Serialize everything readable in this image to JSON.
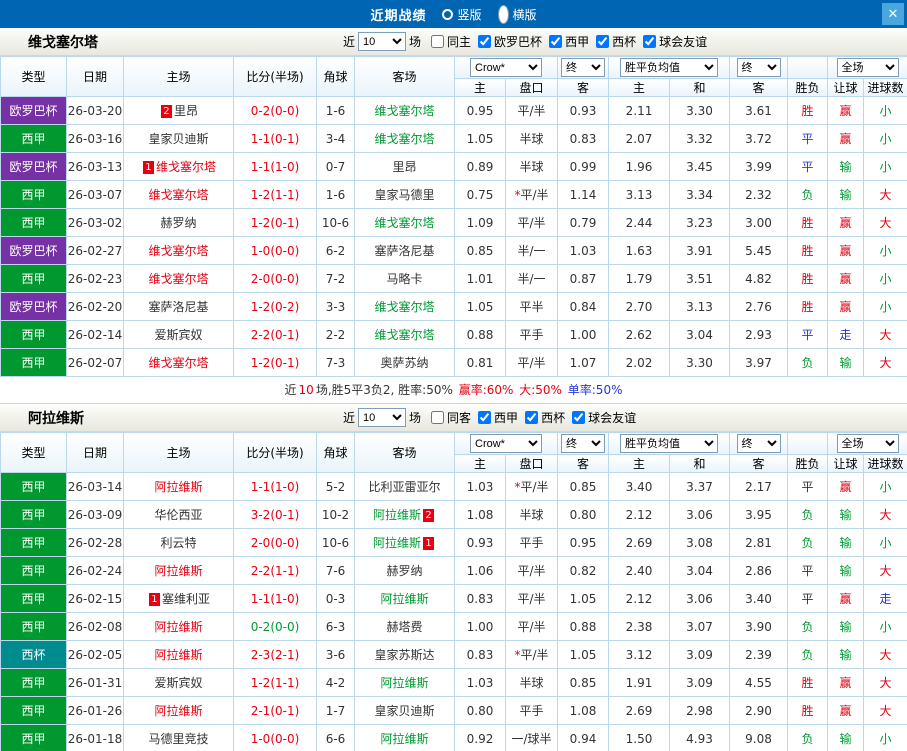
{
  "titlebar": {
    "title": "近期战绩",
    "options": [
      {
        "label": "竖版",
        "selected": false
      },
      {
        "label": "横版",
        "selected": true
      }
    ],
    "close_label": "✕"
  },
  "colors": {
    "header_blue": "#0066b3",
    "close_blue": "#49a7de",
    "red": "#e60012",
    "green": "#009933",
    "blue": "#2437d8",
    "europa_purple": "#7632a4",
    "laliga_green": "#00982f",
    "cup_teal": "#008b8f"
  },
  "columns": {
    "type": "类型",
    "date": "日期",
    "home": "主场",
    "score": "比分(半场)",
    "corner": "角球",
    "away": "客场",
    "odds_home": "主",
    "odds_handicap": "盘口",
    "odds_away": "客",
    "avg_win": "主",
    "avg_draw": "和",
    "avg_lose": "客",
    "result": "胜负",
    "handicap_result": "让球",
    "goals": "进球数"
  },
  "selects": {
    "odds_source": "Crow*",
    "final_a": "终",
    "avg_label": "胜平负均值",
    "final_b": "终",
    "scope": "全场"
  },
  "sections": [
    {
      "team": "维戈塞尔塔",
      "filters": {
        "near": "近",
        "count": "10",
        "games": "场",
        "same": {
          "label": "同主",
          "checked": false
        },
        "leagues": [
          {
            "label": "欧罗巴杯",
            "checked": true
          },
          {
            "label": "西甲",
            "checked": true
          },
          {
            "label": "西杯",
            "checked": true
          },
          {
            "label": "球会友谊",
            "checked": true
          }
        ]
      },
      "rows": [
        {
          "league": "欧罗巴杯",
          "lg": "purple",
          "date": "26-03-20",
          "home": {
            "name": "里昂",
            "color": "black",
            "badge": "2",
            "badge_pos": "before"
          },
          "score": "0-2(0-0)",
          "score_color": "red",
          "corner": "1-6",
          "away": {
            "name": "维戈塞尔塔",
            "color": "green"
          },
          "odds": [
            "0.95",
            "平/半",
            "0.93",
            "2.11",
            "3.30",
            "3.61"
          ],
          "results": [
            [
              "胜",
              "red"
            ],
            [
              "赢",
              "red"
            ],
            [
              "小",
              "green"
            ]
          ]
        },
        {
          "league": "西甲",
          "lg": "green",
          "date": "26-03-16",
          "home": {
            "name": "皇家贝迪斯",
            "color": "black"
          },
          "score": "1-1(0-1)",
          "score_color": "red",
          "corner": "3-4",
          "away": {
            "name": "维戈塞尔塔",
            "color": "green"
          },
          "odds": [
            "1.05",
            "半球",
            "0.83",
            "2.07",
            "3.32",
            "3.72"
          ],
          "results": [
            [
              "平",
              "blue"
            ],
            [
              "赢",
              "red"
            ],
            [
              "小",
              "green"
            ]
          ]
        },
        {
          "league": "欧罗巴杯",
          "lg": "purple",
          "date": "26-03-13",
          "home": {
            "name": "维戈塞尔塔",
            "color": "red",
            "badge": "1",
            "badge_pos": "before"
          },
          "score": "1-1(1-0)",
          "score_color": "red",
          "corner": "0-7",
          "away": {
            "name": "里昂",
            "color": "black"
          },
          "odds": [
            "0.89",
            "半球",
            "0.99",
            "1.96",
            "3.45",
            "3.99"
          ],
          "results": [
            [
              "平",
              "blue"
            ],
            [
              "输",
              "green"
            ],
            [
              "小",
              "green"
            ]
          ]
        },
        {
          "league": "西甲",
          "lg": "green",
          "date": "26-03-07",
          "home": {
            "name": "维戈塞尔塔",
            "color": "red"
          },
          "score": "1-2(1-1)",
          "score_color": "red",
          "corner": "1-6",
          "away": {
            "name": "皇家马德里",
            "color": "black"
          },
          "odds": [
            "0.75",
            "*平/半",
            "1.14",
            "3.13",
            "3.34",
            "2.32"
          ],
          "results": [
            [
              "负",
              "green"
            ],
            [
              "输",
              "green"
            ],
            [
              "大",
              "red"
            ]
          ]
        },
        {
          "league": "西甲",
          "lg": "green",
          "date": "26-03-02",
          "home": {
            "name": "赫罗纳",
            "color": "black"
          },
          "score": "1-2(0-1)",
          "score_color": "red",
          "corner": "10-6",
          "away": {
            "name": "维戈塞尔塔",
            "color": "green"
          },
          "odds": [
            "1.09",
            "平/半",
            "0.79",
            "2.44",
            "3.23",
            "3.00"
          ],
          "results": [
            [
              "胜",
              "red"
            ],
            [
              "赢",
              "red"
            ],
            [
              "大",
              "red"
            ]
          ]
        },
        {
          "league": "欧罗巴杯",
          "lg": "purple",
          "date": "26-02-27",
          "home": {
            "name": "维戈塞尔塔",
            "color": "red"
          },
          "score": "1-0(0-0)",
          "score_color": "red",
          "corner": "6-2",
          "away": {
            "name": "塞萨洛尼基",
            "color": "black"
          },
          "odds": [
            "0.85",
            "半/一",
            "1.03",
            "1.63",
            "3.91",
            "5.45"
          ],
          "results": [
            [
              "胜",
              "red"
            ],
            [
              "赢",
              "red"
            ],
            [
              "小",
              "green"
            ]
          ]
        },
        {
          "league": "西甲",
          "lg": "green",
          "date": "26-02-23",
          "home": {
            "name": "维戈塞尔塔",
            "color": "red"
          },
          "score": "2-0(0-0)",
          "score_color": "red",
          "corner": "7-2",
          "away": {
            "name": "马略卡",
            "color": "black"
          },
          "odds": [
            "1.01",
            "半/一",
            "0.87",
            "1.79",
            "3.51",
            "4.82"
          ],
          "results": [
            [
              "胜",
              "red"
            ],
            [
              "赢",
              "red"
            ],
            [
              "小",
              "green"
            ]
          ]
        },
        {
          "league": "欧罗巴杯",
          "lg": "purple",
          "date": "26-02-20",
          "home": {
            "name": "塞萨洛尼基",
            "color": "black"
          },
          "score": "1-2(0-2)",
          "score_color": "red",
          "corner": "3-3",
          "away": {
            "name": "维戈塞尔塔",
            "color": "green"
          },
          "odds": [
            "1.05",
            "平半",
            "0.84",
            "2.70",
            "3.13",
            "2.76"
          ],
          "results": [
            [
              "胜",
              "red"
            ],
            [
              "赢",
              "red"
            ],
            [
              "小",
              "green"
            ]
          ]
        },
        {
          "league": "西甲",
          "lg": "green",
          "date": "26-02-14",
          "home": {
            "name": "爱斯宾奴",
            "color": "black"
          },
          "score": "2-2(0-1)",
          "score_color": "red",
          "corner": "2-2",
          "away": {
            "name": "维戈塞尔塔",
            "color": "green"
          },
          "odds": [
            "0.88",
            "平手",
            "1.00",
            "2.62",
            "3.04",
            "2.93"
          ],
          "results": [
            [
              "平",
              "blue"
            ],
            [
              "走",
              "blue"
            ],
            [
              "大",
              "red"
            ]
          ]
        },
        {
          "league": "西甲",
          "lg": "green",
          "date": "26-02-07",
          "home": {
            "name": "维戈塞尔塔",
            "color": "red"
          },
          "score": "1-2(0-1)",
          "score_color": "red",
          "corner": "7-3",
          "away": {
            "name": "奥萨苏纳",
            "color": "black"
          },
          "odds": [
            "0.81",
            "平/半",
            "1.07",
            "2.02",
            "3.30",
            "3.97"
          ],
          "results": [
            [
              "负",
              "green"
            ],
            [
              "输",
              "green"
            ],
            [
              "大",
              "red"
            ]
          ]
        }
      ]
    },
    {
      "team": "阿拉维斯",
      "filters": {
        "near": "近",
        "count": "10",
        "games": "场",
        "same": {
          "label": "同客",
          "checked": false
        },
        "leagues": [
          {
            "label": "西甲",
            "checked": true
          },
          {
            "label": "西杯",
            "checked": true
          },
          {
            "label": "球会友谊",
            "checked": true
          }
        ]
      },
      "rows": [
        {
          "league": "西甲",
          "lg": "green",
          "date": "26-03-14",
          "home": {
            "name": "阿拉维斯",
            "color": "red"
          },
          "score": "1-1(1-0)",
          "score_color": "red",
          "corner": "5-2",
          "away": {
            "name": "比利亚雷亚尔",
            "color": "black"
          },
          "odds": [
            "1.03",
            "*平/半",
            "0.85",
            "3.40",
            "3.37",
            "2.17"
          ],
          "results": [
            [
              "平",
              "black"
            ],
            [
              "赢",
              "red"
            ],
            [
              "小",
              "green"
            ]
          ]
        },
        {
          "league": "西甲",
          "lg": "green",
          "date": "26-03-09",
          "home": {
            "name": "华伦西亚",
            "color": "black"
          },
          "score": "3-2(0-1)",
          "score_color": "red",
          "corner": "10-2",
          "away": {
            "name": "阿拉维斯",
            "color": "green",
            "badge": "2",
            "badge_pos": "after"
          },
          "odds": [
            "1.08",
            "半球",
            "0.80",
            "2.12",
            "3.06",
            "3.95"
          ],
          "results": [
            [
              "负",
              "green"
            ],
            [
              "输",
              "green"
            ],
            [
              "大",
              "red"
            ]
          ]
        },
        {
          "league": "西甲",
          "lg": "green",
          "date": "26-02-28",
          "home": {
            "name": "利云特",
            "color": "black"
          },
          "score": "2-0(0-0)",
          "score_color": "red",
          "corner": "10-6",
          "away": {
            "name": "阿拉维斯",
            "color": "green",
            "badge": "1",
            "badge_pos": "after"
          },
          "odds": [
            "0.93",
            "平手",
            "0.95",
            "2.69",
            "3.08",
            "2.81"
          ],
          "results": [
            [
              "负",
              "green"
            ],
            [
              "输",
              "green"
            ],
            [
              "小",
              "green"
            ]
          ]
        },
        {
          "league": "西甲",
          "lg": "green",
          "date": "26-02-24",
          "home": {
            "name": "阿拉维斯",
            "color": "red"
          },
          "score": "2-2(1-1)",
          "score_color": "red",
          "corner": "7-6",
          "away": {
            "name": "赫罗纳",
            "color": "black"
          },
          "odds": [
            "1.06",
            "平/半",
            "0.82",
            "2.40",
            "3.04",
            "2.86"
          ],
          "results": [
            [
              "平",
              "black"
            ],
            [
              "输",
              "green"
            ],
            [
              "大",
              "red"
            ]
          ]
        },
        {
          "league": "西甲",
          "lg": "green",
          "date": "26-02-15",
          "home": {
            "name": "塞维利亚",
            "color": "black",
            "badge": "1",
            "badge_pos": "before"
          },
          "score": "1-1(1-0)",
          "score_color": "red",
          "corner": "0-3",
          "away": {
            "name": "阿拉维斯",
            "color": "green"
          },
          "odds": [
            "0.83",
            "平/半",
            "1.05",
            "2.12",
            "3.06",
            "3.40"
          ],
          "results": [
            [
              "平",
              "black"
            ],
            [
              "赢",
              "red"
            ],
            [
              "走",
              "blue"
            ]
          ]
        },
        {
          "league": "西甲",
          "lg": "green",
          "date": "26-02-08",
          "home": {
            "name": "阿拉维斯",
            "color": "red"
          },
          "score": "0-2(0-0)",
          "score_color": "green",
          "corner": "6-3",
          "away": {
            "name": "赫塔费",
            "color": "black"
          },
          "odds": [
            "1.00",
            "平/半",
            "0.88",
            "2.38",
            "3.07",
            "3.90"
          ],
          "results": [
            [
              "负",
              "green"
            ],
            [
              "输",
              "green"
            ],
            [
              "小",
              "green"
            ]
          ]
        },
        {
          "league": "西杯",
          "lg": "teal",
          "date": "26-02-05",
          "home": {
            "name": "阿拉维斯",
            "color": "red"
          },
          "score": "2-3(2-1)",
          "score_color": "red",
          "corner": "3-6",
          "away": {
            "name": "皇家苏斯达",
            "color": "black"
          },
          "odds": [
            "0.83",
            "*平/半",
            "1.05",
            "3.12",
            "3.09",
            "2.39"
          ],
          "results": [
            [
              "负",
              "green"
            ],
            [
              "输",
              "green"
            ],
            [
              "大",
              "red"
            ]
          ]
        },
        {
          "league": "西甲",
          "lg": "green",
          "date": "26-01-31",
          "home": {
            "name": "爱斯宾奴",
            "color": "black"
          },
          "score": "1-2(1-1)",
          "score_color": "red",
          "corner": "4-2",
          "away": {
            "name": "阿拉维斯",
            "color": "green"
          },
          "odds": [
            "1.03",
            "半球",
            "0.85",
            "1.91",
            "3.09",
            "4.55"
          ],
          "results": [
            [
              "胜",
              "red"
            ],
            [
              "赢",
              "red"
            ],
            [
              "大",
              "red"
            ]
          ]
        },
        {
          "league": "西甲",
          "lg": "green",
          "date": "26-01-26",
          "home": {
            "name": "阿拉维斯",
            "color": "red"
          },
          "score": "2-1(0-1)",
          "score_color": "red",
          "corner": "1-7",
          "away": {
            "name": "皇家贝迪斯",
            "color": "black"
          },
          "odds": [
            "0.80",
            "平手",
            "1.08",
            "2.69",
            "2.98",
            "2.90"
          ],
          "results": [
            [
              "胜",
              "red"
            ],
            [
              "赢",
              "red"
            ],
            [
              "大",
              "red"
            ]
          ]
        },
        {
          "league": "西甲",
          "lg": "green",
          "date": "26-01-18",
          "home": {
            "name": "马德里竞技",
            "color": "black"
          },
          "score": "1-0(0-0)",
          "score_color": "red",
          "corner": "6-6",
          "away": {
            "name": "阿拉维斯",
            "color": "green"
          },
          "odds": [
            "0.92",
            "一/球半",
            "0.94",
            "1.50",
            "4.93",
            "9.08"
          ],
          "results": [
            [
              "负",
              "green"
            ],
            [
              "输",
              "green"
            ],
            [
              "小",
              "green"
            ]
          ]
        }
      ]
    }
  ],
  "summary": {
    "segments": [
      {
        "text": "近",
        "color": "black"
      },
      {
        "text": "10",
        "color": "red"
      },
      {
        "text": "场,胜5平3负2, 胜率:50% ",
        "color": "black"
      },
      {
        "text": "赢率:60% ",
        "color": "red"
      },
      {
        "text": "大:50% ",
        "color": "red"
      },
      {
        "text": "单率:50%",
        "color": "blue"
      }
    ]
  }
}
